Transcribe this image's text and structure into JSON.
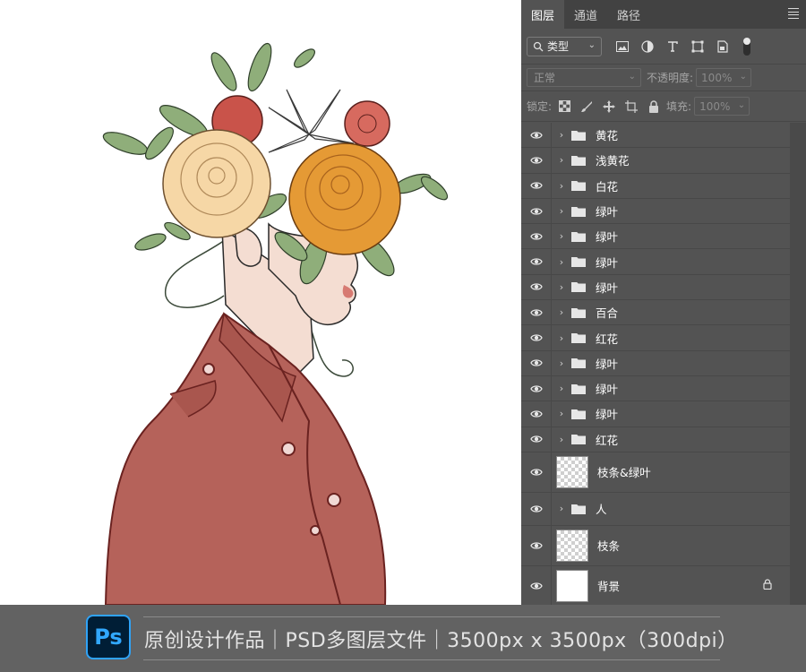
{
  "panel": {
    "tabs": [
      "图层",
      "通道",
      "路径"
    ],
    "filter": {
      "label": "类型"
    },
    "blend_mode": "正常",
    "opacity_label": "不透明度:",
    "opacity_value": "100%",
    "lock_label": "锁定:",
    "fill_label": "填充:",
    "fill_value": "100%",
    "layers": [
      {
        "name": "黄花",
        "type": "group"
      },
      {
        "name": "浅黄花",
        "type": "group"
      },
      {
        "name": "白花",
        "type": "group"
      },
      {
        "name": "绿叶",
        "type": "group"
      },
      {
        "name": "绿叶",
        "type": "group"
      },
      {
        "name": "绿叶",
        "type": "group"
      },
      {
        "name": "绿叶",
        "type": "group"
      },
      {
        "name": "百合",
        "type": "group"
      },
      {
        "name": "红花",
        "type": "group"
      },
      {
        "name": "绿叶",
        "type": "group"
      },
      {
        "name": "绿叶",
        "type": "group"
      },
      {
        "name": "绿叶",
        "type": "group"
      },
      {
        "name": "红花",
        "type": "group"
      },
      {
        "name": "枝条&绿叶",
        "type": "pixel"
      },
      {
        "name": "人",
        "type": "group"
      },
      {
        "name": "枝条",
        "type": "pixel"
      },
      {
        "name": "背景",
        "type": "background",
        "locked": true
      }
    ]
  },
  "footer": {
    "logo_text": "Ps",
    "caption": "原创设计作品｜PSD多图层文件｜3500px x 3500px（300dpi）"
  },
  "colors": {
    "panel_bg": "#535353",
    "tab_bar_bg": "#424242",
    "footer_bg": "#626262",
    "coat": "#b5625a",
    "skin": "#f4ddd2",
    "orange_rose": "#e59a35",
    "cream_rose": "#f6d7a6",
    "leaf": "#8fae7a"
  }
}
